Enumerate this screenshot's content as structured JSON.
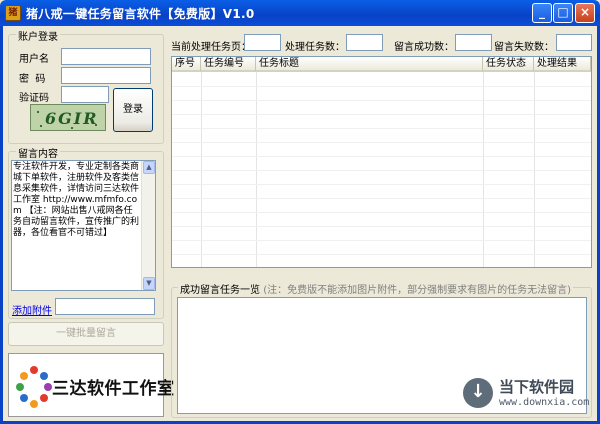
{
  "window": {
    "title": "猪八戒一键任务留言软件【免费版】V1.0",
    "icon_text": "猪"
  },
  "controls": {
    "minimize": "_",
    "maximize": "□",
    "close": "×"
  },
  "login": {
    "group_title": "账户登录",
    "username_label": "用户名",
    "username_value": "",
    "password_label": "密  码",
    "password_value": "",
    "captcha_label": "验证码",
    "captcha_value": "",
    "captcha_image_text": "6GIR",
    "login_button": "登录"
  },
  "message": {
    "group_title": "留言内容",
    "content": "专注软件开发，专业定制各类商城下单软件，注册软件及客类信息采集软件，详情访问三达软件工作室 http://www.mfmfo.com 【注：网站出售八戒网各任务自动留言软件，宣传推广的利器，各位看官不可错过】",
    "add_attachment_link": "添加附件",
    "attachment_value": "",
    "batch_button": "一键批量留言"
  },
  "stats": {
    "current_page_label": "当前处理任务页：",
    "current_page_value": "",
    "tasks_count_label": "处理任务数：",
    "tasks_count_value": "",
    "success_label": "留言成功数：",
    "success_value": "",
    "fail_label": "留言失败数：",
    "fail_value": ""
  },
  "table": {
    "columns": [
      "序号",
      "任务编号",
      "任务标题",
      "任务状态",
      "处理结果"
    ]
  },
  "success_panel": {
    "title": "成功留言任务一览",
    "note": "(注：免费版不能添加图片附件，部分强制要求有图片的任务无法留言)"
  },
  "logo": {
    "text": "三达软件工作室"
  },
  "watermark": {
    "title": "当下软件园",
    "url": "www.downxia.com"
  },
  "colors": {
    "titlebar": "#0842C6",
    "window_bg": "#ECE9D8",
    "link": "#0000EE"
  }
}
